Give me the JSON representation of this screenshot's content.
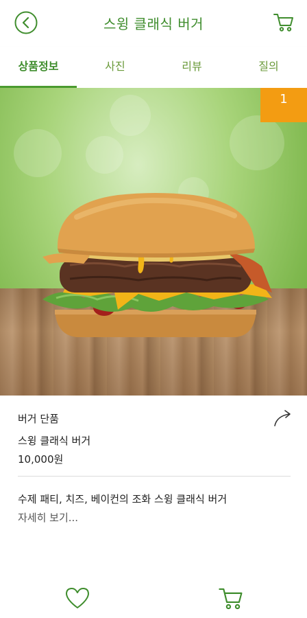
{
  "header": {
    "title": "스윙 클래식 버거",
    "back_icon": "chevron-left-circle-icon",
    "cart_icon": "cart-icon"
  },
  "tabs": [
    {
      "label": "상품정보",
      "active": true
    },
    {
      "label": "사진",
      "active": false
    },
    {
      "label": "리뷰",
      "active": false
    },
    {
      "label": "질의",
      "active": false
    }
  ],
  "hero": {
    "image": "burger-photo",
    "badge": "1"
  },
  "product": {
    "category": "버거 단품",
    "name": "스윙 클래식 버거",
    "price": "10,000원",
    "description": "수제 패티, 치즈, 베이컨의 조화 스윙 클래식 버거",
    "more_link": "자세히 보기..."
  },
  "bottom_bar": {
    "like_icon": "heart-icon",
    "cart_icon": "cart-icon"
  },
  "colors": {
    "accent": "#3f8d2d",
    "badge": "#f39c12"
  }
}
